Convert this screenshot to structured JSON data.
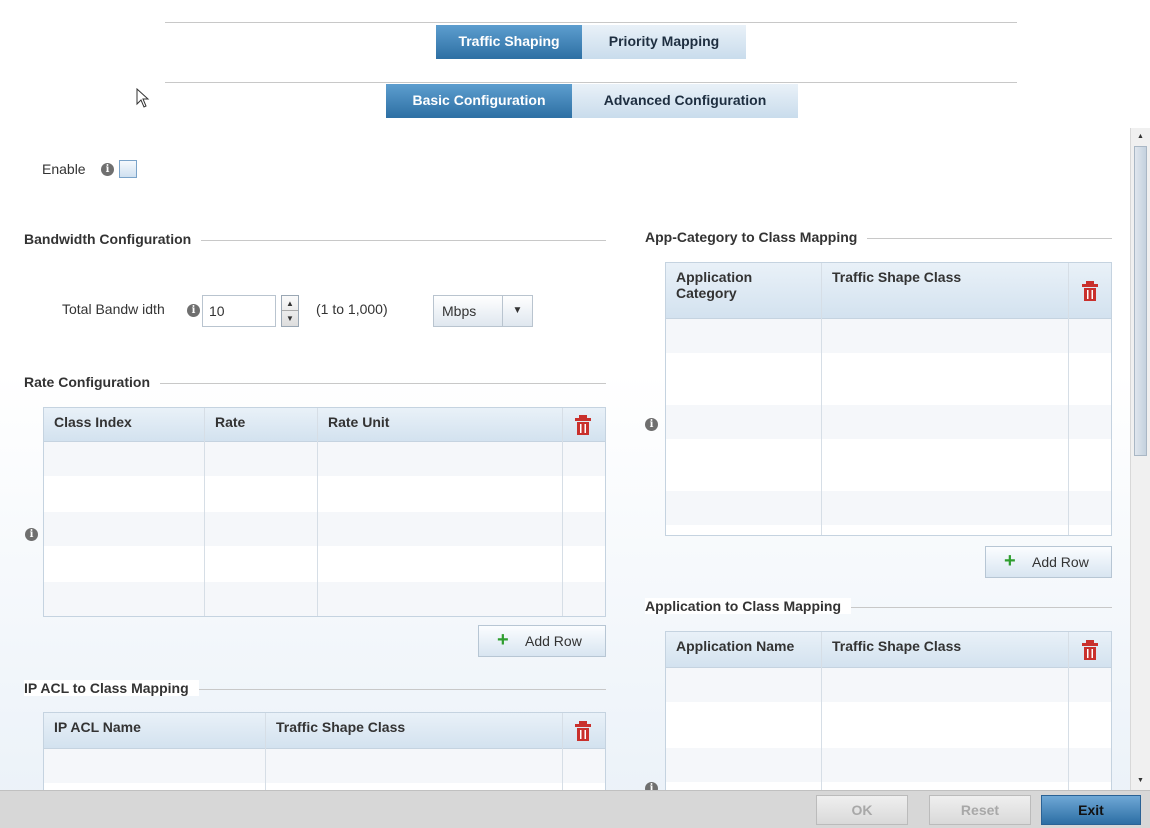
{
  "top_tabs": [
    {
      "label": "Traffic Shaping",
      "active": true
    },
    {
      "label": "Priority Mapping",
      "active": false
    }
  ],
  "sub_tabs": [
    {
      "label": "Basic Configuration",
      "active": true
    },
    {
      "label": "Advanced Configuration",
      "active": false
    }
  ],
  "enable": {
    "label": "Enable",
    "checked": false
  },
  "bandwidth": {
    "section_title": "Bandwidth Configuration",
    "total_label": "Total Bandw idth",
    "value": "10",
    "range_hint": "(1 to 1,000)",
    "unit": "Mbps"
  },
  "rate_config": {
    "section_title": "Rate Configuration",
    "columns": [
      "Class Index",
      "Rate",
      "Rate Unit"
    ],
    "add_row_label": "Add Row"
  },
  "ip_acl": {
    "section_title": "IP ACL to Class Mapping",
    "columns": [
      "IP ACL Name",
      "Traffic Shape Class"
    ]
  },
  "app_category": {
    "section_title": "App-Category to Class Mapping",
    "columns": [
      "Application Category",
      "Traffic Shape Class"
    ],
    "add_row_label": "Add Row"
  },
  "application": {
    "section_title": "Application to Class Mapping",
    "columns": [
      "Application Name",
      "Traffic Shape Class"
    ]
  },
  "footer": {
    "ok_label": "OK",
    "reset_label": "Reset",
    "exit_label": "Exit"
  },
  "colors": {
    "active_tab": "#3a7db3",
    "inactive_tab": "#d6e5f2",
    "delete_icon": "#c9302c",
    "add_icon": "#2f9e2f"
  },
  "icons": [
    "info-icon",
    "trash-icon",
    "plus-icon",
    "cursor-arrow-icon",
    "chevron-down-icon"
  ]
}
